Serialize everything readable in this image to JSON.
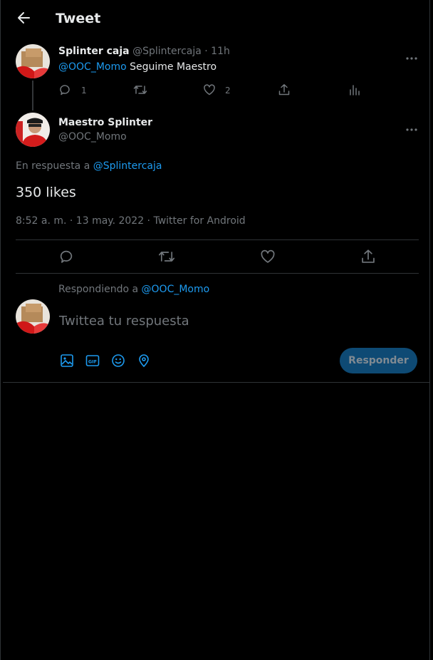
{
  "header": {
    "title": "Tweet"
  },
  "parent_tweet": {
    "display_name": "Splinter caja",
    "handle": "@Splintercaja",
    "time": "· 11h",
    "mention": "@OOC_Momo",
    "text": "Seguime Maestro",
    "reply_count": "1",
    "like_count": "2"
  },
  "main_tweet": {
    "display_name": "Maestro Splinter",
    "handle": "@OOC_Momo",
    "in_reply_prefix": "En respuesta a",
    "in_reply_handle": "@Splintercaja",
    "text": "350 likes",
    "timestamp": "8:52 a. m. · 13 may. 2022 · Twitter for Android"
  },
  "composer": {
    "replying_prefix": "Respondiendo a",
    "replying_handle": "@OOC_Momo",
    "placeholder": "Twittea tu respuesta",
    "submit_label": "Responder"
  },
  "icons": [
    "back-arrow-icon",
    "more-icon",
    "reply-icon",
    "retweet-icon",
    "like-icon",
    "share-icon",
    "analytics-icon",
    "image-icon",
    "gif-icon",
    "emoji-icon",
    "location-icon"
  ],
  "colors": {
    "background": "#000000",
    "accent": "#1d9bf0",
    "muted": "#71767b",
    "button_disabled": "#0e4a74"
  }
}
